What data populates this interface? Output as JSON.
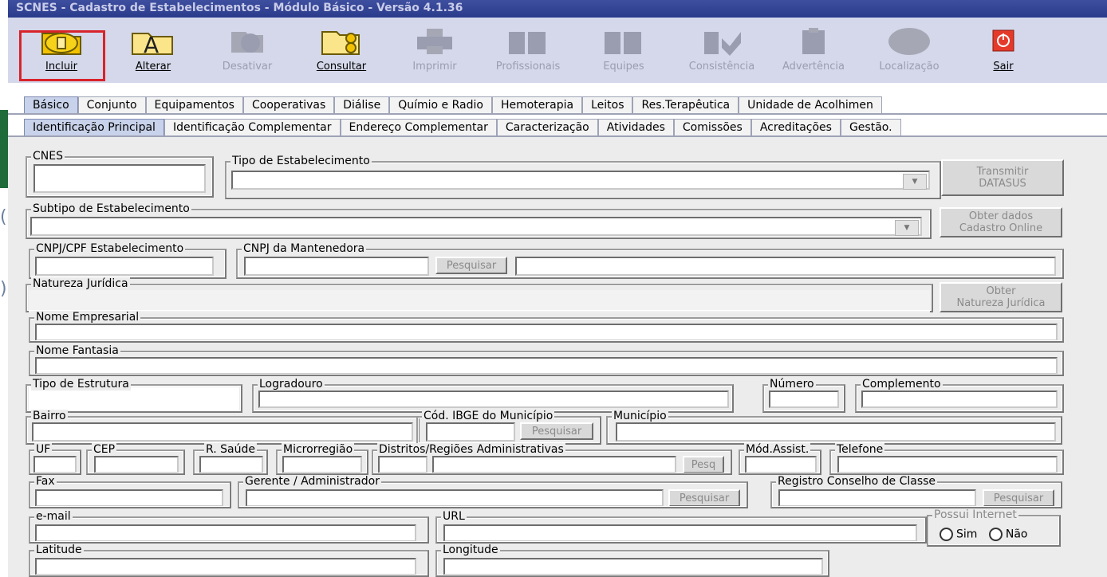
{
  "window": {
    "title": "SCNES - Cadastro de Estabelecimentos - Módulo Básico - Versão 4.1.36"
  },
  "toolbar": {
    "incluir": "Incluir",
    "alterar": "Alterar",
    "desativar": "Desativar",
    "consultar": "Consultar",
    "imprimir": "Imprimir",
    "profissionais": "Profissionais",
    "equipes": "Equipes",
    "consistencia": "Consistência",
    "advertencia": "Advertência",
    "localizacao": "Localização",
    "sair": "Sair"
  },
  "tabs_top": [
    "Básico",
    "Conjunto",
    "Equipamentos",
    "Cooperativas",
    "Diálise",
    "Químio e Radio",
    "Hemoterapia",
    "Leitos",
    "Res.Terapêutica",
    "Unidade de Acolhimen"
  ],
  "tabs_sub": [
    "Identificação Principal",
    "Identificação Complementar",
    "Endereço Complementar",
    "Caracterização",
    "Atividades",
    "Comissões",
    "Acreditações",
    "Gestão."
  ],
  "fields": {
    "cnes": "CNES",
    "tipo_estabelecimento": "Tipo de Estabelecimento",
    "subtipo": "Subtipo de Estabelecimento",
    "cnpj_cpf": "CNPJ/CPF Estabelecimento",
    "cnpj_mantenedora": "CNPJ da Mantenedora",
    "natureza_juridica": "Natureza Jurídica",
    "nome_empresarial": "Nome Empresarial",
    "nome_fantasia": "Nome Fantasia",
    "tipo_estrutura": "Tipo de Estrutura",
    "logradouro": "Logradouro",
    "numero": "Número",
    "complemento": "Complemento",
    "bairro": "Bairro",
    "cod_ibge": "Cód. IBGE do Município",
    "municipio": "Município",
    "uf": "UF",
    "cep": "CEP",
    "r_saude": "R. Saúde",
    "microrregiao": "Microrregião",
    "distritos": "Distritos/Regiões Administrativas",
    "mod_assist": "Mód.Assist.",
    "telefone": "Telefone",
    "fax": "Fax",
    "gerente": "Gerente / Administrador",
    "registro_conselho": "Registro Conselho de Classe",
    "email": "e-mail",
    "url": "URL",
    "possui_internet": "Possui Internet",
    "sim": "Sim",
    "nao": "Não",
    "latitude": "Latitude",
    "longitude": "Longitude"
  },
  "buttons": {
    "transmitir_1": "Transmitir",
    "transmitir_2": "DATASUS",
    "obter_dados_1": "Obter dados",
    "obter_dados_2": "Cadastro Online",
    "pesquisar": "Pesquisar",
    "pesq": "Pesq",
    "obter_nat_1": "Obter",
    "obter_nat_2": "Natureza Jurídica"
  },
  "colors": {
    "titlebar": "#2a3b8c",
    "toolbar": "#d4d8ea",
    "highlight": "#d8232a",
    "form_bg": "#ececec"
  }
}
